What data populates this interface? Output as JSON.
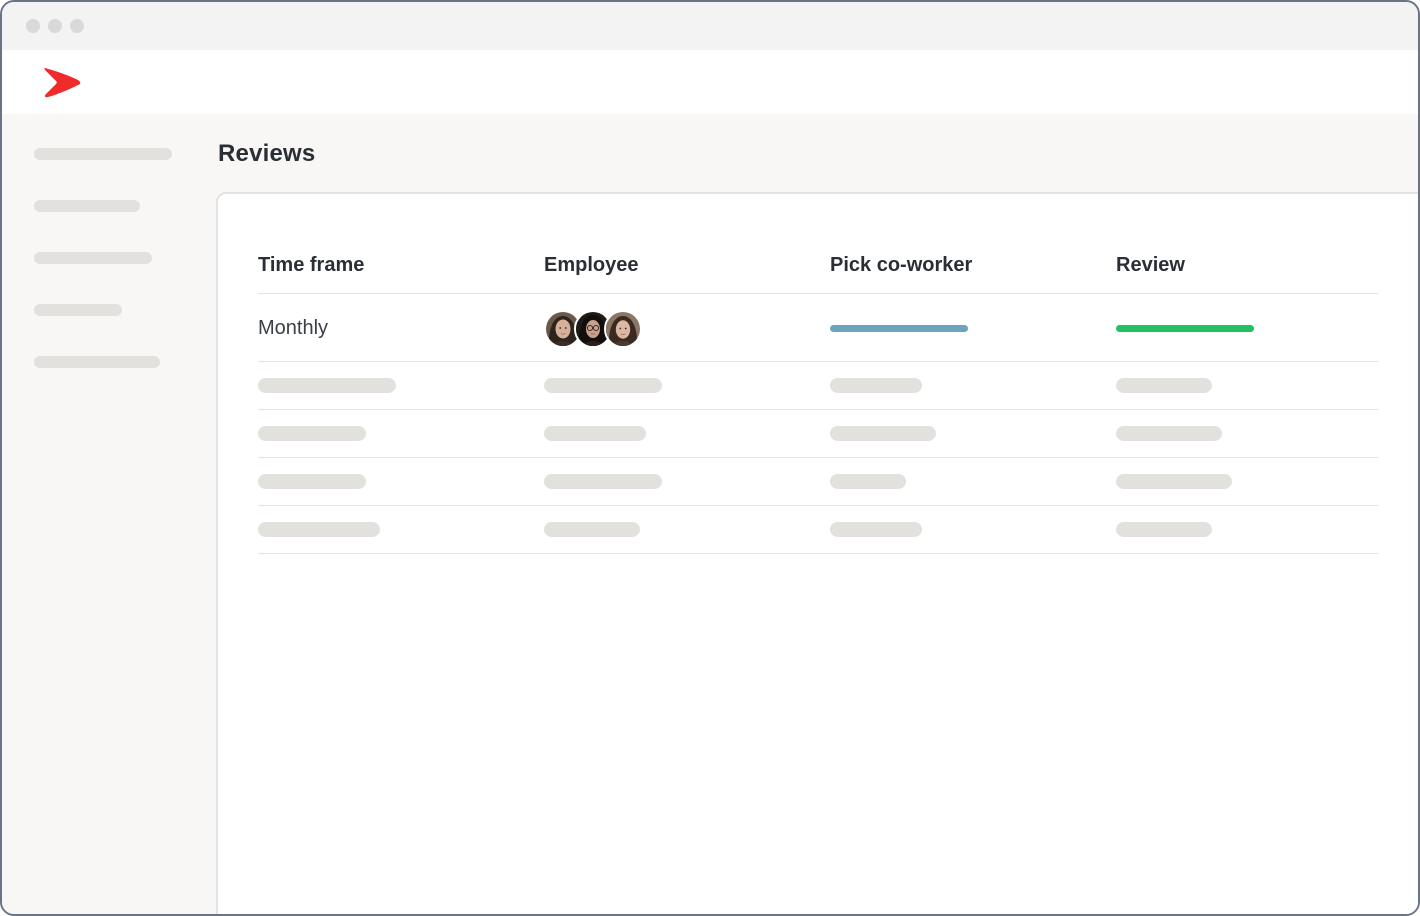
{
  "window": {
    "traffic_lights": [
      "close-dot",
      "minimize-dot",
      "maximize-dot"
    ]
  },
  "header": {
    "logo_icon": "red-chevron-logo-icon",
    "logo_color": "#ef2b2b"
  },
  "main": {
    "title": "Reviews",
    "table": {
      "columns": [
        "Time frame",
        "Employee",
        "Pick co-worker",
        "Review"
      ],
      "rows": [
        {
          "time_frame": "Monthly",
          "employee_avatars": [
            "woman-avatar-icon",
            "woman-with-glasses-avatar-icon",
            "woman-avatar-icon"
          ],
          "pick_coworker_progress": 1.0,
          "pick_coworker_color": "#6ea3bf",
          "review_progress": 1.0,
          "review_color": "#22bf63"
        }
      ]
    }
  },
  "colors": {
    "accent_blue": "#6ea3bf",
    "accent_green": "#22bf63",
    "placeholder": "#e2e1de"
  }
}
